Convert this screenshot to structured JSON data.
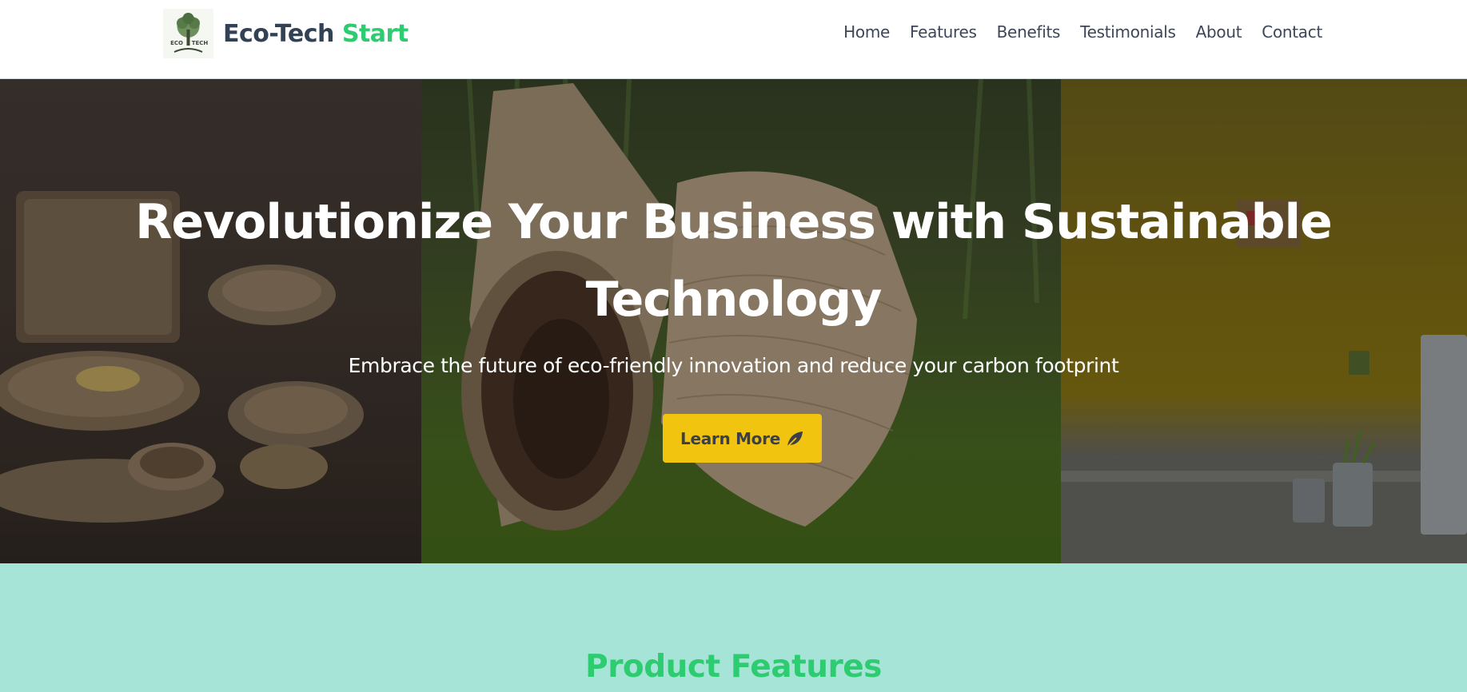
{
  "header": {
    "brand_main": "Eco-Tech",
    "brand_accent": "Start",
    "logo_icon": "eco-tech-tree-logo",
    "nav": [
      {
        "label": "Home"
      },
      {
        "label": "Features"
      },
      {
        "label": "Benefits"
      },
      {
        "label": "Testimonials"
      },
      {
        "label": "About"
      },
      {
        "label": "Contact"
      }
    ]
  },
  "hero": {
    "title": "Revolutionize Your Business with Sustainable Technology",
    "subtitle": "Embrace the future of eco-friendly innovation and reduce your carbon footprint",
    "button_label": "Learn More",
    "button_icon": "leaf-icon",
    "image": "hero-image-eco-tableware"
  },
  "features": {
    "title": "Product Features"
  },
  "colors": {
    "accent_green": "#2ecc71",
    "button_yellow": "#f1c40f",
    "features_bg": "#a6e4d7",
    "brand_dark": "#334155"
  }
}
